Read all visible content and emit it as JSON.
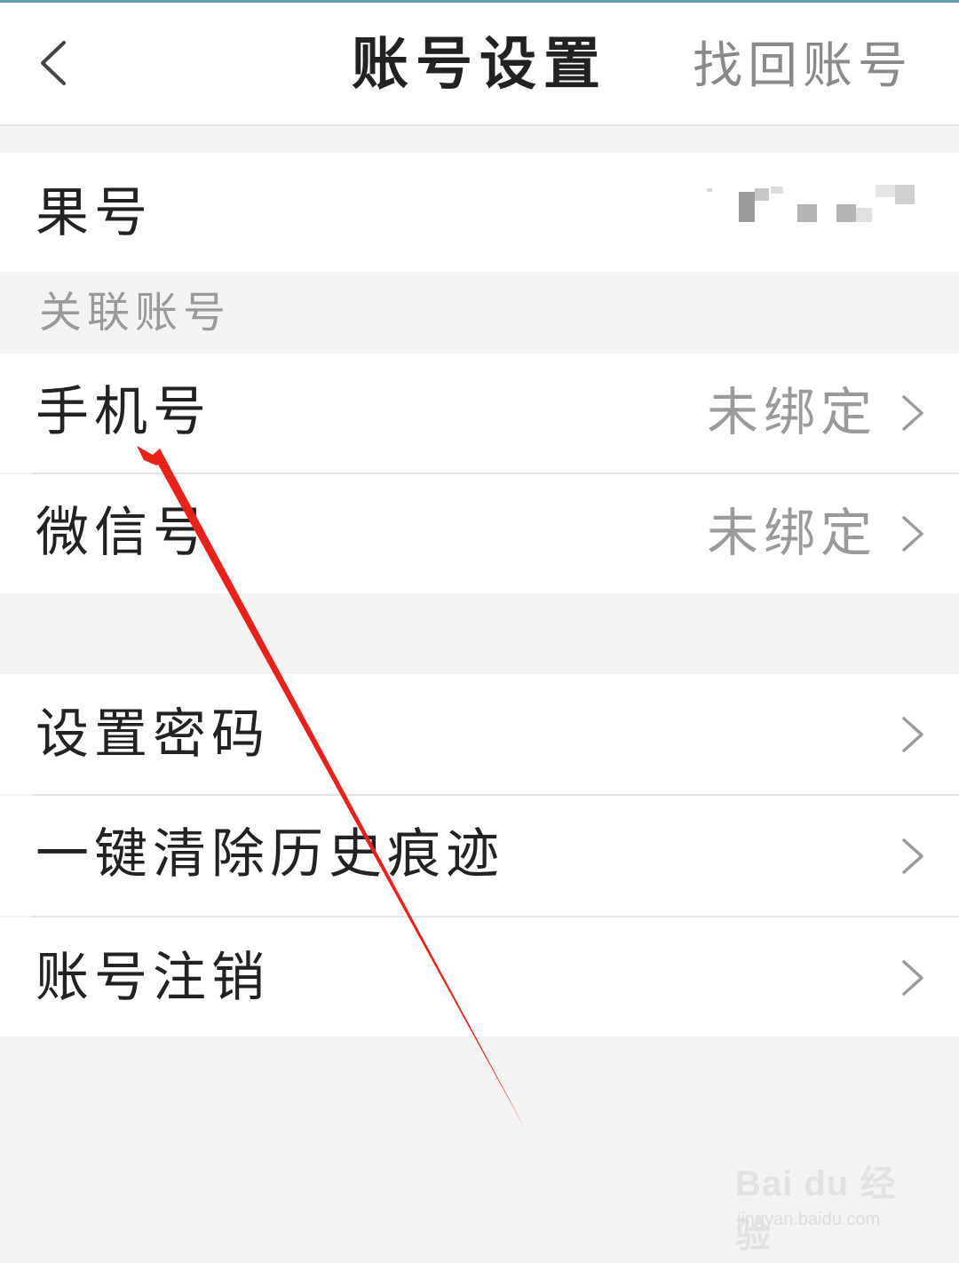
{
  "header": {
    "title": "账号设置",
    "action_label": "找回账号"
  },
  "account": {
    "label": "果号"
  },
  "linked_section": {
    "title": "关联账号",
    "items": [
      {
        "label": "手机号",
        "status": "未绑定"
      },
      {
        "label": "微信号",
        "status": "未绑定"
      }
    ]
  },
  "actions": [
    {
      "label": "设置密码"
    },
    {
      "label": "一键清除历史痕迹"
    },
    {
      "label": "账号注销"
    }
  ],
  "watermark": {
    "brand": "Bai du 经验",
    "url": "jingyan.baidu.com"
  },
  "colors": {
    "annotation_arrow": "#e8221b",
    "secondary_text": "#9a9a9a",
    "page_background": "#f3f3f3"
  }
}
